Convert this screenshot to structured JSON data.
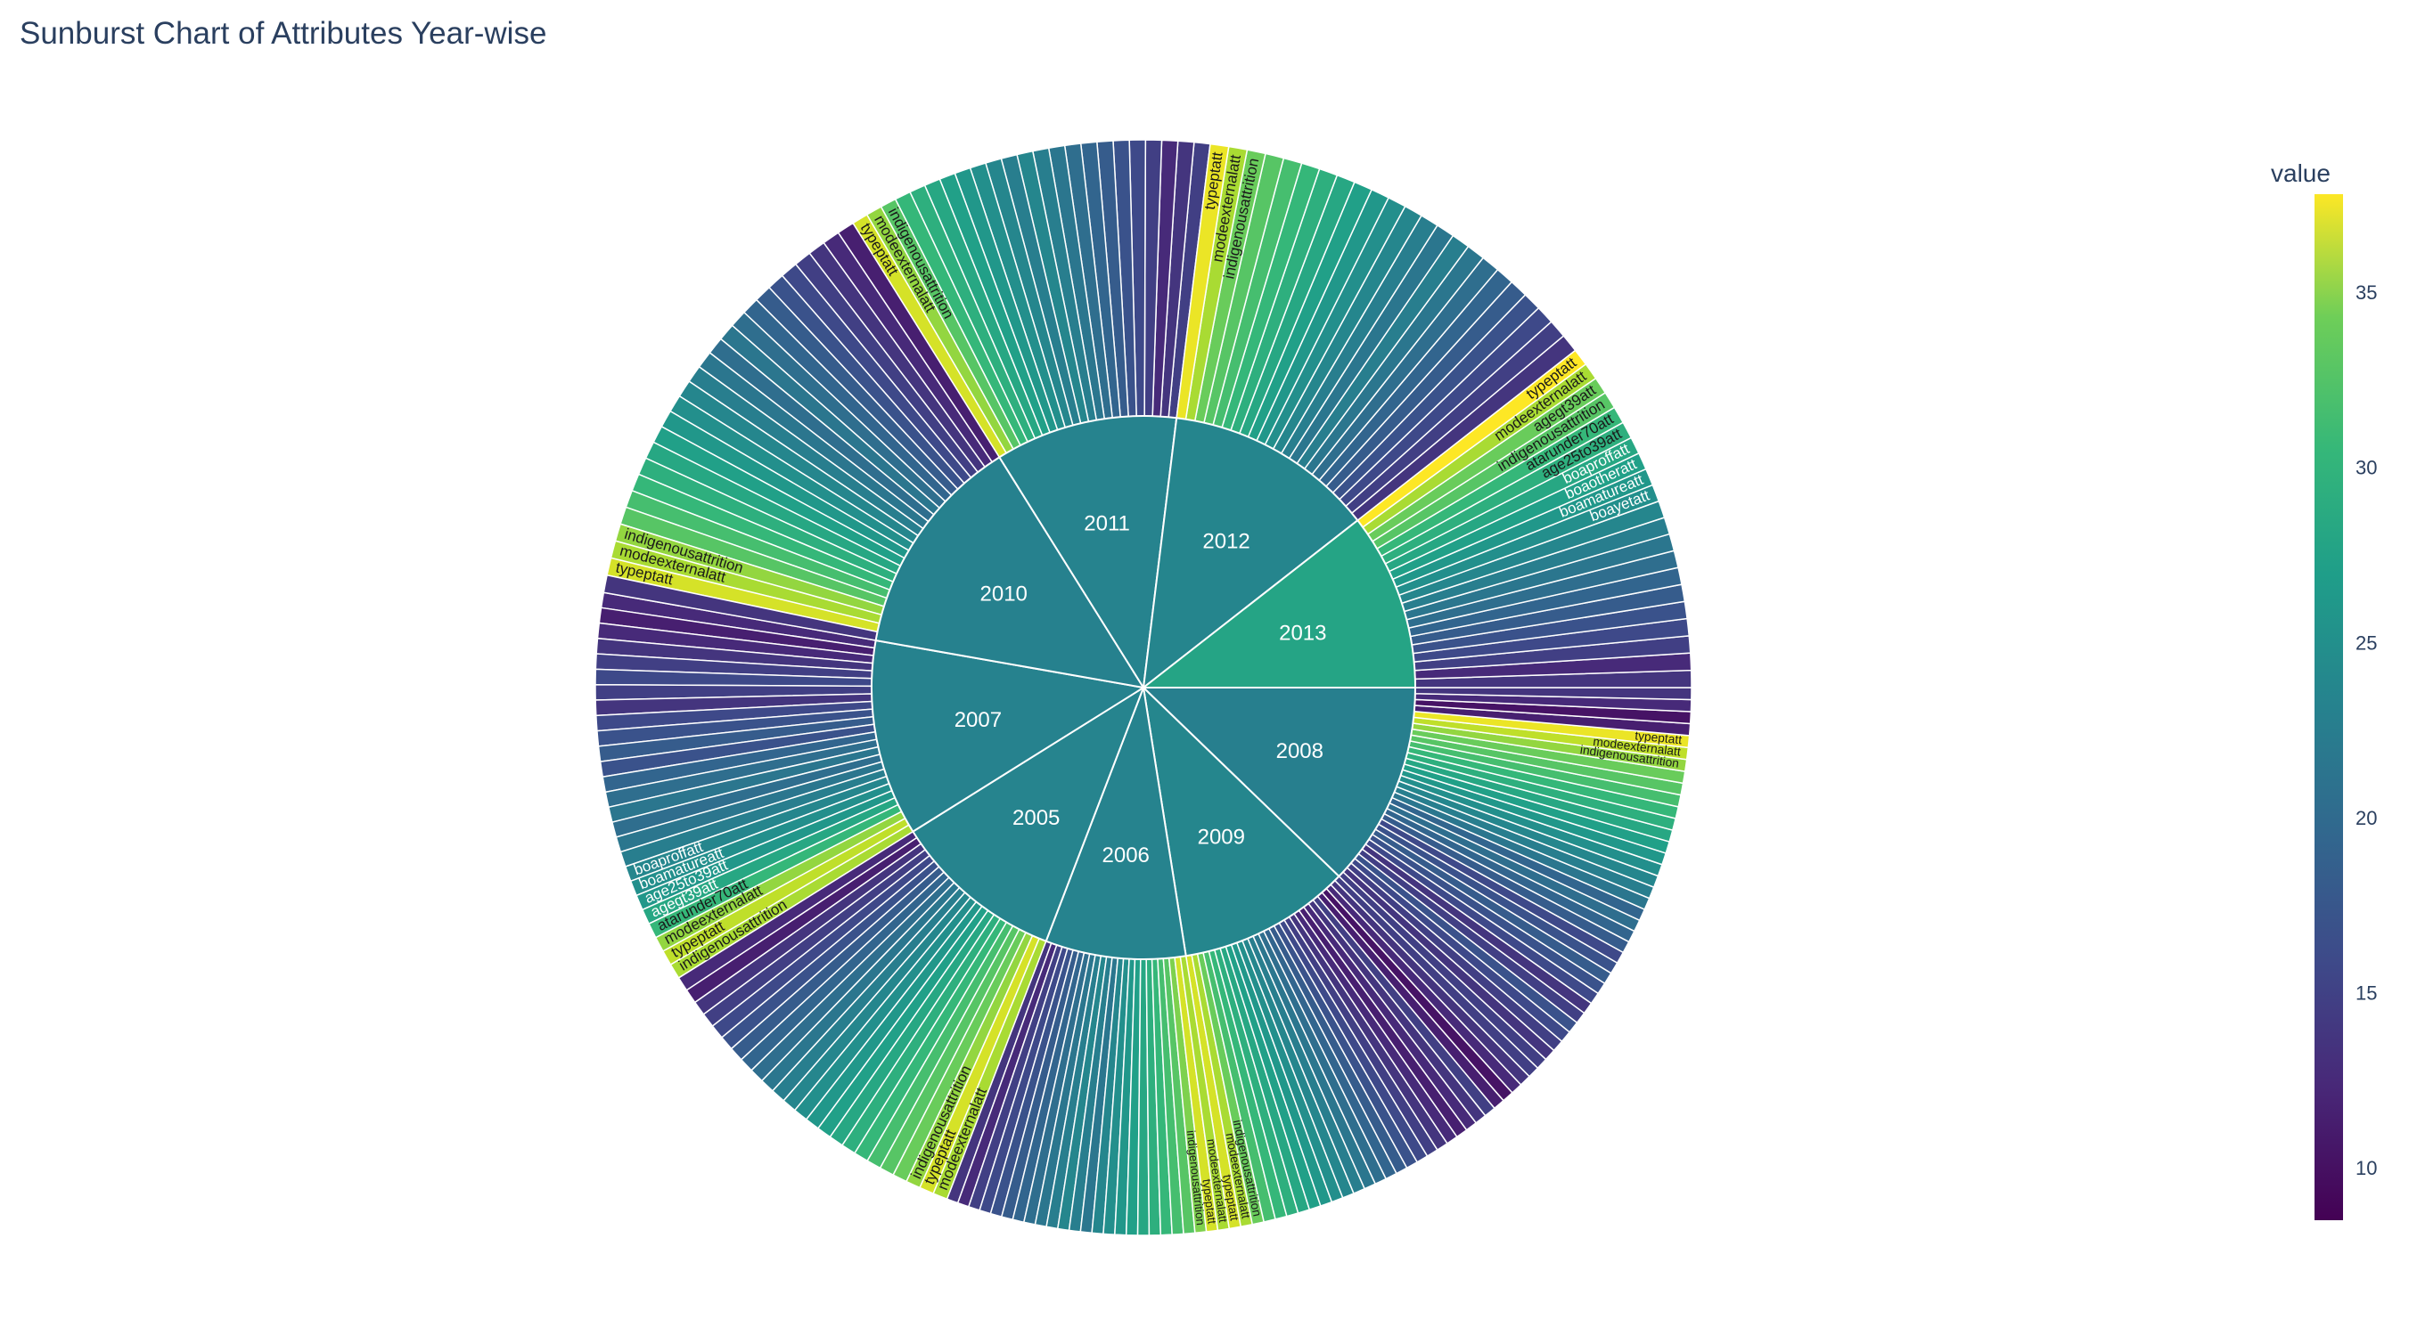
{
  "chart_data": {
    "type": "sunburst",
    "title": "Sunburst Chart of Attributes Year-wise",
    "colorscale": "viridis",
    "colorbar": {
      "title": "value",
      "range": [
        8.5,
        37.8
      ],
      "ticks": [
        10,
        15,
        20,
        25,
        30,
        35
      ]
    },
    "years": [
      {
        "name": "2008",
        "value": 21.2,
        "leaves": [
          {
            "label": "",
            "value": 14
          },
          {
            "label": "",
            "value": 13
          },
          {
            "label": "",
            "value": 14
          },
          {
            "label": "",
            "value": 15
          },
          {
            "label": "",
            "value": 16
          },
          {
            "label": "",
            "value": 14
          },
          {
            "label": "",
            "value": 13
          },
          {
            "label": "",
            "value": 15
          },
          {
            "label": "",
            "value": 16
          },
          {
            "label": "",
            "value": 17
          },
          {
            "label": "",
            "value": 16
          },
          {
            "label": "",
            "value": 15
          },
          {
            "label": "",
            "value": 17
          },
          {
            "label": "",
            "value": 18
          },
          {
            "label": "",
            "value": 19
          },
          {
            "label": "",
            "value": 18
          },
          {
            "label": "",
            "value": 20
          },
          {
            "label": "",
            "value": 21
          },
          {
            "label": "",
            "value": 22
          },
          {
            "label": "",
            "value": 23
          },
          {
            "label": "",
            "value": 24
          },
          {
            "label": "",
            "value": 25
          },
          {
            "label": "",
            "value": 26
          },
          {
            "label": "",
            "value": 27
          },
          {
            "label": "",
            "value": 28
          },
          {
            "label": "",
            "value": 29
          },
          {
            "label": "",
            "value": 30
          },
          {
            "label": "",
            "value": 31
          },
          {
            "label": "indigenousattrition",
            "value": 33
          },
          {
            "label": "modeexternalatt",
            "value": 35
          },
          {
            "label": "typeptatt",
            "value": 37
          },
          {
            "label": "",
            "value": 11
          },
          {
            "label": "",
            "value": 10
          },
          {
            "label": "",
            "value": 12
          },
          {
            "label": "",
            "value": 13
          }
        ]
      },
      {
        "name": "2009",
        "value": 22.0,
        "leaves": [
          {
            "label": "typeptatt",
            "value": 36
          },
          {
            "label": "modeexternalatt",
            "value": 34
          },
          {
            "label": "indigenousattrition",
            "value": 31
          },
          {
            "label": "",
            "value": 29
          },
          {
            "label": "",
            "value": 28
          },
          {
            "label": "",
            "value": 27
          },
          {
            "label": "",
            "value": 26
          },
          {
            "label": "",
            "value": 25
          },
          {
            "label": "",
            "value": 24
          },
          {
            "label": "",
            "value": 23
          },
          {
            "label": "",
            "value": 22
          },
          {
            "label": "",
            "value": 21
          },
          {
            "label": "",
            "value": 20
          },
          {
            "label": "",
            "value": 19
          },
          {
            "label": "",
            "value": 18
          },
          {
            "label": "",
            "value": 17
          },
          {
            "label": "",
            "value": 16
          },
          {
            "label": "",
            "value": 15
          },
          {
            "label": "",
            "value": 14
          },
          {
            "label": "",
            "value": 13
          },
          {
            "label": "",
            "value": 12
          },
          {
            "label": "",
            "value": 11
          },
          {
            "label": "",
            "value": 12
          },
          {
            "label": "",
            "value": 13
          },
          {
            "label": "",
            "value": 14
          },
          {
            "label": "",
            "value": 11
          },
          {
            "label": "",
            "value": 10
          },
          {
            "label": "",
            "value": 12
          },
          {
            "label": "",
            "value": 13
          },
          {
            "label": "",
            "value": 14
          }
        ]
      },
      {
        "name": "2006",
        "value": 21.6,
        "leaves": [
          {
            "label": "",
            "value": 13
          },
          {
            "label": "",
            "value": 12
          },
          {
            "label": "",
            "value": 14
          },
          {
            "label": "",
            "value": 15
          },
          {
            "label": "",
            "value": 16
          },
          {
            "label": "",
            "value": 17
          },
          {
            "label": "",
            "value": 18
          },
          {
            "label": "",
            "value": 19
          },
          {
            "label": "",
            "value": 20
          },
          {
            "label": "",
            "value": 21
          },
          {
            "label": "",
            "value": 22
          },
          {
            "label": "",
            "value": 21
          },
          {
            "label": "",
            "value": 20
          },
          {
            "label": "",
            "value": 22
          },
          {
            "label": "",
            "value": 23
          },
          {
            "label": "",
            "value": 24
          },
          {
            "label": "",
            "value": 25
          },
          {
            "label": "",
            "value": 26
          },
          {
            "label": "",
            "value": 27
          },
          {
            "label": "",
            "value": 28
          },
          {
            "label": "",
            "value": 29
          },
          {
            "label": "",
            "value": 30
          },
          {
            "label": "indigenousattrition",
            "value": 32
          },
          {
            "label": "typeptatt",
            "value": 36
          },
          {
            "label": "modeexternalatt",
            "value": 34
          }
        ]
      },
      {
        "name": "2005",
        "value": 21.7,
        "leaves": [
          {
            "label": "",
            "value": 12
          },
          {
            "label": "",
            "value": 11
          },
          {
            "label": "",
            "value": 13
          },
          {
            "label": "",
            "value": 14
          },
          {
            "label": "",
            "value": 15
          },
          {
            "label": "",
            "value": 16
          },
          {
            "label": "",
            "value": 17
          },
          {
            "label": "",
            "value": 18
          },
          {
            "label": "",
            "value": 19
          },
          {
            "label": "",
            "value": 20
          },
          {
            "label": "",
            "value": 21
          },
          {
            "label": "",
            "value": 22
          },
          {
            "label": "",
            "value": 23
          },
          {
            "label": "",
            "value": 24
          },
          {
            "label": "",
            "value": 25
          },
          {
            "label": "",
            "value": 26
          },
          {
            "label": "",
            "value": 27
          },
          {
            "label": "",
            "value": 28
          },
          {
            "label": "",
            "value": 29
          },
          {
            "label": "",
            "value": 30
          },
          {
            "label": "",
            "value": 31
          },
          {
            "label": "indigenousattrition",
            "value": 33
          },
          {
            "label": "typeptatt",
            "value": 36
          },
          {
            "label": "modeexternalatt",
            "value": 34
          }
        ]
      },
      {
        "name": "2007",
        "value": 21.5,
        "leaves": [
          {
            "label": "",
            "value": 12
          },
          {
            "label": "",
            "value": 11
          },
          {
            "label": "",
            "value": 12
          },
          {
            "label": "",
            "value": 13
          },
          {
            "label": "",
            "value": 14
          },
          {
            "label": "",
            "value": 15
          },
          {
            "label": "",
            "value": 14
          },
          {
            "label": "",
            "value": 13
          },
          {
            "label": "",
            "value": 15
          },
          {
            "label": "",
            "value": 16
          },
          {
            "label": "",
            "value": 17
          },
          {
            "label": "",
            "value": 16
          },
          {
            "label": "",
            "value": 18
          },
          {
            "label": "",
            "value": 19
          },
          {
            "label": "",
            "value": 20
          },
          {
            "label": "",
            "value": 19
          },
          {
            "label": "",
            "value": 20
          },
          {
            "label": "",
            "value": 21
          },
          {
            "label": "boaproffatt",
            "value": 22
          },
          {
            "label": "boamatureatt",
            "value": 23
          },
          {
            "label": "age25to39att",
            "value": 24
          },
          {
            "label": "agegt39att",
            "value": 26
          },
          {
            "label": "atarunder70att",
            "value": 28
          },
          {
            "label": "modeexternalatt",
            "value": 33
          },
          {
            "label": "typeptatt",
            "value": 35
          },
          {
            "label": "indigenousattrition",
            "value": 34
          }
        ]
      },
      {
        "name": "2010",
        "value": 21.4,
        "leaves": [
          {
            "label": "",
            "value": 11
          },
          {
            "label": "",
            "value": 12
          },
          {
            "label": "",
            "value": 13
          },
          {
            "label": "",
            "value": 14
          },
          {
            "label": "",
            "value": 15
          },
          {
            "label": "",
            "value": 16
          },
          {
            "label": "",
            "value": 17
          },
          {
            "label": "",
            "value": 18
          },
          {
            "label": "",
            "value": 19
          },
          {
            "label": "",
            "value": 20
          },
          {
            "label": "",
            "value": 19
          },
          {
            "label": "",
            "value": 20
          },
          {
            "label": "",
            "value": 21
          },
          {
            "label": "",
            "value": 22
          },
          {
            "label": "",
            "value": 23
          },
          {
            "label": "",
            "value": 24
          },
          {
            "label": "",
            "value": 25
          },
          {
            "label": "",
            "value": 26
          },
          {
            "label": "",
            "value": 27
          },
          {
            "label": "",
            "value": 28
          },
          {
            "label": "",
            "value": 29
          },
          {
            "label": "",
            "value": 30
          },
          {
            "label": "indigenousattrition",
            "value": 33
          },
          {
            "label": "modeexternalatt",
            "value": 34
          },
          {
            "label": "typeptatt",
            "value": 36
          },
          {
            "label": "",
            "value": 13
          }
        ]
      },
      {
        "name": "2011",
        "value": 21.6,
        "leaves": [
          {
            "label": "",
            "value": 14
          },
          {
            "label": "",
            "value": 13
          },
          {
            "label": "",
            "value": 12
          },
          {
            "label": "",
            "value": 14
          },
          {
            "label": "",
            "value": 15
          },
          {
            "label": "",
            "value": 16
          },
          {
            "label": "",
            "value": 17
          },
          {
            "label": "",
            "value": 18
          },
          {
            "label": "",
            "value": 19
          },
          {
            "label": "",
            "value": 20
          },
          {
            "label": "",
            "value": 21
          },
          {
            "label": "",
            "value": 22
          },
          {
            "label": "",
            "value": 21
          },
          {
            "label": "",
            "value": 22
          },
          {
            "label": "",
            "value": 23
          },
          {
            "label": "",
            "value": 24
          },
          {
            "label": "",
            "value": 25
          },
          {
            "label": "",
            "value": 26
          },
          {
            "label": "",
            "value": 27
          },
          {
            "label": "",
            "value": 28
          },
          {
            "label": "indigenousattrition",
            "value": 30
          },
          {
            "label": "modeexternalatt",
            "value": 33
          },
          {
            "label": "typeptatt",
            "value": 36
          }
        ]
      },
      {
        "name": "2012",
        "value": 21.9,
        "leaves": [
          {
            "label": "",
            "value": 13
          },
          {
            "label": "",
            "value": 14
          },
          {
            "label": "",
            "value": 15
          },
          {
            "label": "",
            "value": 16
          },
          {
            "label": "",
            "value": 17
          },
          {
            "label": "",
            "value": 18
          },
          {
            "label": "",
            "value": 19
          },
          {
            "label": "",
            "value": 20
          },
          {
            "label": "",
            "value": 21
          },
          {
            "label": "",
            "value": 20
          },
          {
            "label": "",
            "value": 21
          },
          {
            "label": "",
            "value": 22
          },
          {
            "label": "",
            "value": 23
          },
          {
            "label": "",
            "value": 24
          },
          {
            "label": "",
            "value": 25
          },
          {
            "label": "",
            "value": 26
          },
          {
            "label": "",
            "value": 27
          },
          {
            "label": "",
            "value": 28
          },
          {
            "label": "",
            "value": 29
          },
          {
            "label": "",
            "value": 30
          },
          {
            "label": "indigenousattrition",
            "value": 31
          },
          {
            "label": "modeexternalatt",
            "value": 34
          },
          {
            "label": "typeptatt",
            "value": 37
          }
        ]
      },
      {
        "name": "2013",
        "value": 25.6,
        "leaves": [
          {
            "label": "",
            "value": 13
          },
          {
            "label": "",
            "value": 12
          },
          {
            "label": "",
            "value": 14
          },
          {
            "label": "",
            "value": 15
          },
          {
            "label": "",
            "value": 16
          },
          {
            "label": "",
            "value": 17
          },
          {
            "label": "",
            "value": 18
          },
          {
            "label": "",
            "value": 19
          },
          {
            "label": "",
            "value": 20
          },
          {
            "label": "",
            "value": 21
          },
          {
            "label": "",
            "value": 22
          },
          {
            "label": "boayetatt",
            "value": 23
          },
          {
            "label": "boamatureatt",
            "value": 24
          },
          {
            "label": "boaotheratt",
            "value": 25
          },
          {
            "label": "boaproffatt",
            "value": 26
          },
          {
            "label": "age25to39att",
            "value": 27
          },
          {
            "label": "atarunder70att",
            "value": 28
          },
          {
            "label": "indigenousattrition",
            "value": 30
          },
          {
            "label": "agegt39att",
            "value": 31
          },
          {
            "label": "modeexternalatt",
            "value": 34
          },
          {
            "label": "typeptatt",
            "value": 38
          }
        ]
      }
    ]
  }
}
